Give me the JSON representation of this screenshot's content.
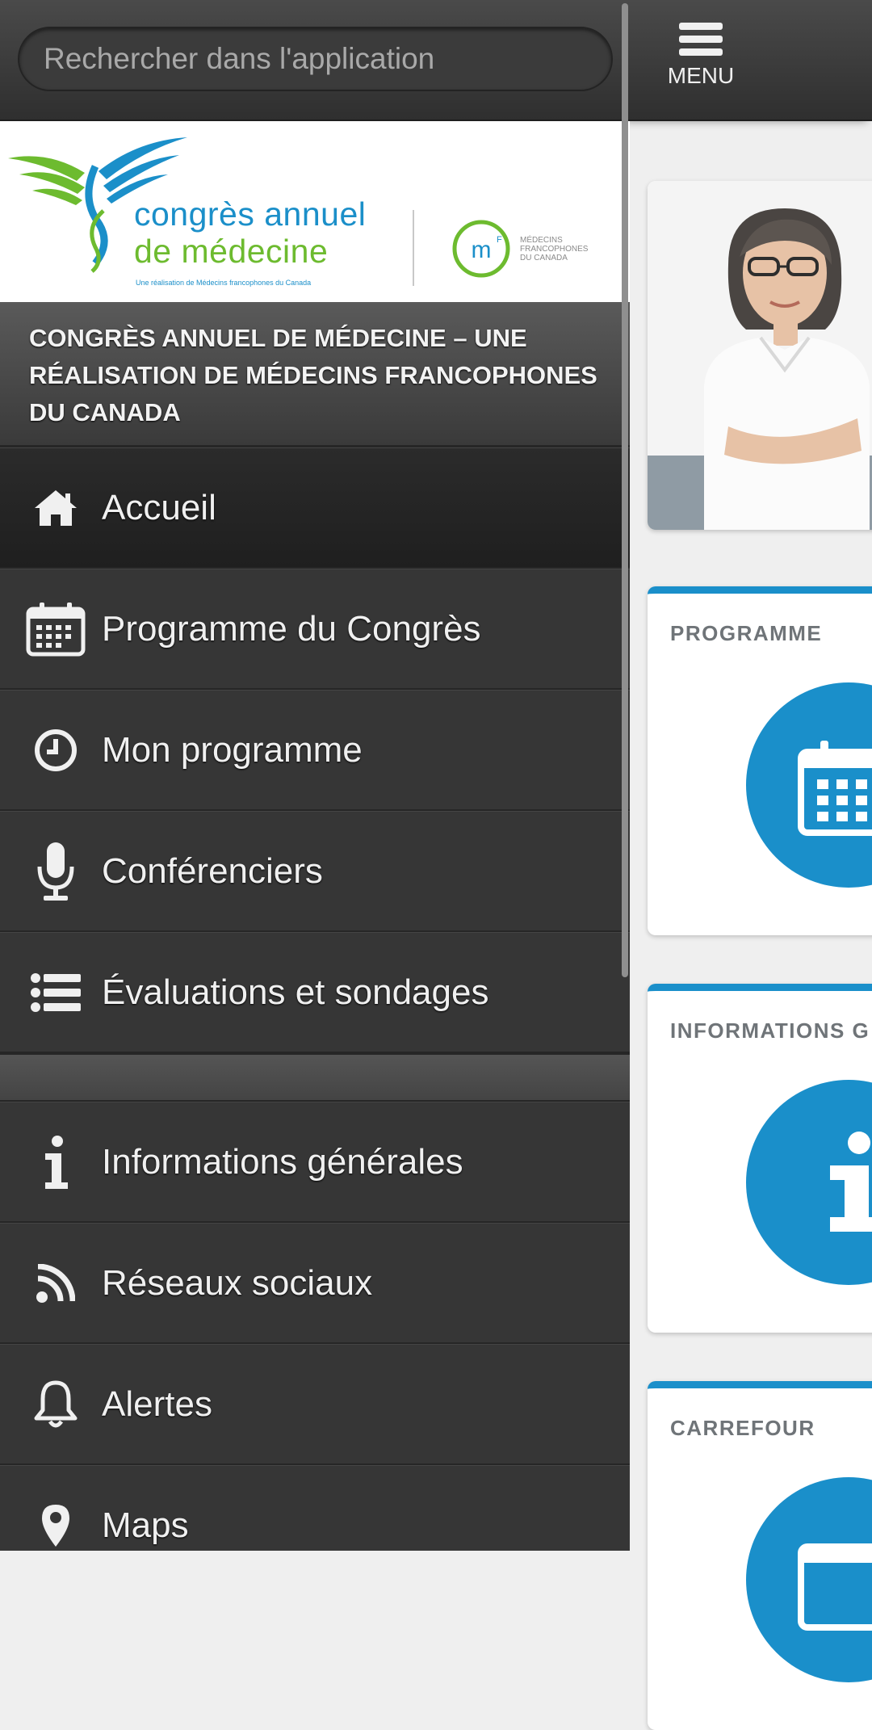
{
  "search": {
    "placeholder": "Rechercher dans l'application"
  },
  "header": {
    "menu_label": "MENU"
  },
  "logo": {
    "line1": "congrès annuel",
    "line2": "de médecine",
    "tagline": "Une réalisation de Médecins francophones du Canada",
    "partner": [
      "MÉDECINS",
      "FRANCOPHONES",
      "DU CANADA"
    ]
  },
  "drawer_title": "CONGRÈS ANNUEL DE MÉDECINE – UNE RÉALISATION DE MÉDECINS FRANCOPHONES DU CANADA",
  "menu": {
    "items": [
      {
        "label": "Accueil",
        "icon": "home-icon",
        "active": true
      },
      {
        "label": "Programme du Congrès",
        "icon": "calendar-icon"
      },
      {
        "label": "Mon programme",
        "icon": "clock-icon"
      },
      {
        "label": "Conférenciers",
        "icon": "microphone-icon"
      },
      {
        "label": "Évaluations et sondages",
        "icon": "list-icon"
      }
    ],
    "items2": [
      {
        "label": "Informations générales",
        "icon": "info-icon"
      },
      {
        "label": "Réseaux sociaux",
        "icon": "rss-icon"
      },
      {
        "label": "Alertes",
        "icon": "bell-icon"
      },
      {
        "label": "Maps",
        "icon": "map-pin-icon"
      }
    ]
  },
  "tiles": [
    {
      "label": "PROGRAMME",
      "icon": "calendar-icon"
    },
    {
      "label": "INFORMATIONS G",
      "icon": "info-icon"
    },
    {
      "label": "CARREFOUR",
      "icon": "calendar-icon"
    }
  ],
  "colors": {
    "accent": "#1a8fca",
    "logo_blue": "#1b8fc9",
    "logo_green": "#6dbb2f",
    "drawer_bg": "#353535"
  }
}
